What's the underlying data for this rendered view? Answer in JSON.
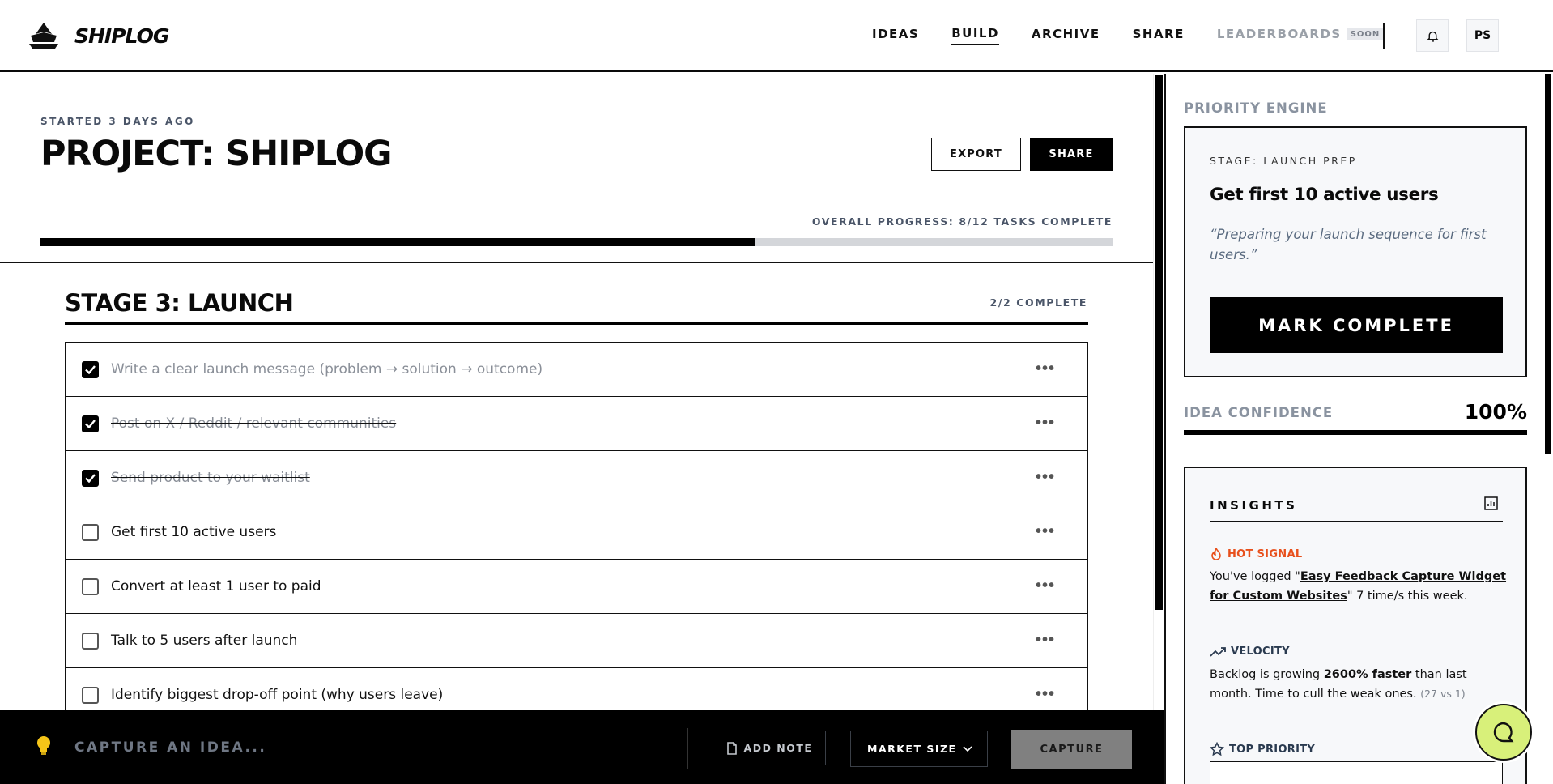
{
  "header": {
    "brand": "SHIPLOG",
    "nav": [
      {
        "label": "IDEAS",
        "active": false
      },
      {
        "label": "BUILD",
        "active": true
      },
      {
        "label": "ARCHIVE",
        "active": false
      },
      {
        "label": "SHARE",
        "active": false
      },
      {
        "label": "LEADERBOARDS",
        "active": false,
        "disabled": true
      }
    ],
    "soon_badge": "SOON",
    "avatar_initials": "PS",
    "icons": {
      "bell": "bell-icon",
      "logo": "ship-logo-icon"
    }
  },
  "project": {
    "started": "STARTED 3 DAYS AGO",
    "title": "PROJECT: SHIPLOG",
    "export_label": "EXPORT",
    "share_label": "SHARE",
    "progress_label": "OVERALL PROGRESS: 8/12 TASKS COMPLETE",
    "progress_fraction": 0.6667
  },
  "stage": {
    "title": "STAGE 3: LAUNCH",
    "count": "2/2 COMPLETE",
    "tasks": [
      {
        "text": "Write a clear launch message (problem → solution → outcome)",
        "done": true
      },
      {
        "text": "Post on X / Reddit / relevant communities",
        "done": true
      },
      {
        "text": "Send product to your waitlist",
        "done": true
      },
      {
        "text": "Get first 10 active users",
        "done": false
      },
      {
        "text": "Convert at least 1 user to paid",
        "done": false
      },
      {
        "text": "Talk to 5 users after launch",
        "done": false
      },
      {
        "text": "Identify biggest drop-off point (why users leave)",
        "done": false
      }
    ],
    "more_label": "•••"
  },
  "capture_bar": {
    "placeholder": "CAPTURE AN IDEA...",
    "add_note_label": "ADD NOTE",
    "market_size_label": "MARKET SIZE",
    "capture_label": "CAPTURE"
  },
  "sidebar": {
    "heading": "PRIORITY ENGINE",
    "stage_label": "STAGE: LAUNCH PREP",
    "priority_title": "Get first 10 active users",
    "priority_quote": "“Preparing your launch sequence for first users.”",
    "mark_complete_label": "MARK COMPLETE",
    "confidence_label": "IDEA CONFIDENCE",
    "confidence_value": "100%",
    "confidence_fraction": 1.0,
    "insights": {
      "heading": "INSIGHTS",
      "hot_signal_label": "HOT SIGNAL",
      "hot_signal_prefix": "You've logged \"",
      "hot_signal_link": "Easy Feedback Capture Widget for Custom Websites",
      "hot_signal_suffix": "\" 7 time/s this week.",
      "velocity_label": "VELOCITY",
      "velocity_prefix": "Backlog is growing ",
      "velocity_strong": "2600% faster",
      "velocity_suffix": " than last month. Time to cull the weak ones.",
      "velocity_note": "(27 vs 1)",
      "top_priority_label": "TOP PRIORITY"
    }
  },
  "colors": {
    "accent": "#000000",
    "hot_signal": "#e8501c",
    "muted_text": "#8a93a0",
    "chat_fab": "#d8f07a"
  }
}
